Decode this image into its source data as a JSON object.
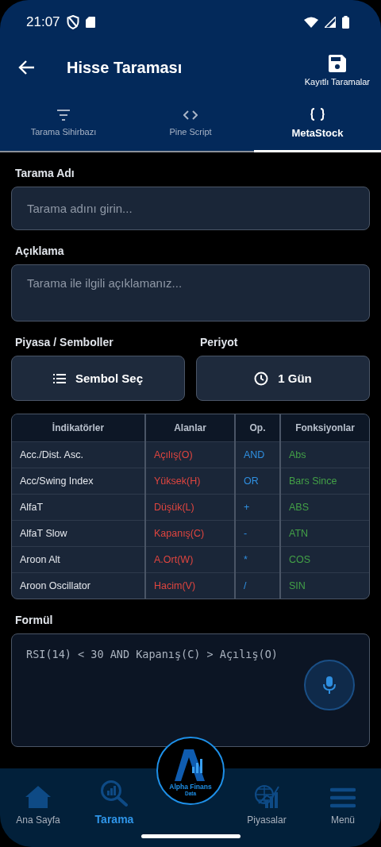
{
  "status_bar": {
    "time": "21:07"
  },
  "header": {
    "title": "Hisse Taraması",
    "saved_label": "Kayıtlı Taramalar"
  },
  "tabs": [
    {
      "label": "Tarama Sihirbazı",
      "selected": false
    },
    {
      "label": "Pine Script",
      "selected": false
    },
    {
      "label": "MetaStock",
      "selected": true
    }
  ],
  "form": {
    "name_label": "Tarama Adı",
    "name_placeholder": "Tarama adını girin...",
    "desc_label": "Açıklama",
    "desc_placeholder": "Tarama ile ilgili açıklamanız...",
    "market_label": "Piyasa / Semboller",
    "period_label": "Periyot",
    "symbol_button": "Sembol Seç",
    "period_button": "1 Gün"
  },
  "table": {
    "columns": [
      {
        "header": "İndikatörler",
        "color": "#e6e9ee",
        "items": [
          "Acc./Dist. Asc.",
          "Acc/Swing Index",
          "AlfaT",
          "AlfaT Slow",
          "Aroon Alt",
          "Aroon Oscillator"
        ]
      },
      {
        "header": "Alanlar",
        "color": "#e0453f",
        "items": [
          "Açılış(O)",
          "Yüksek(H)",
          "Düşük(L)",
          "Kapanış(C)",
          "A.Ort(W)",
          "Hacim(V)"
        ]
      },
      {
        "header": "Op.",
        "color": "#2f8fe0",
        "items": [
          "AND",
          "OR",
          "+",
          "-",
          "*",
          "/"
        ]
      },
      {
        "header": "Fonksiyonlar",
        "color": "#43a047",
        "items": [
          "Abs",
          "Bars Since",
          "ABS",
          "ATN",
          "COS",
          "SIN"
        ]
      }
    ]
  },
  "formula": {
    "label": "Formül",
    "value": "RSI(14) < 30 AND Kapanış(C) > Açılış(O)"
  },
  "logo": {
    "line1": "Alpha Finans",
    "line2": "Data"
  },
  "bottom_nav": [
    {
      "label": "Ana Sayfa",
      "selected": false
    },
    {
      "label": "Tarama",
      "selected": true
    },
    {
      "label": "Piyasalar",
      "selected": false
    },
    {
      "label": "Menü",
      "selected": false
    }
  ]
}
